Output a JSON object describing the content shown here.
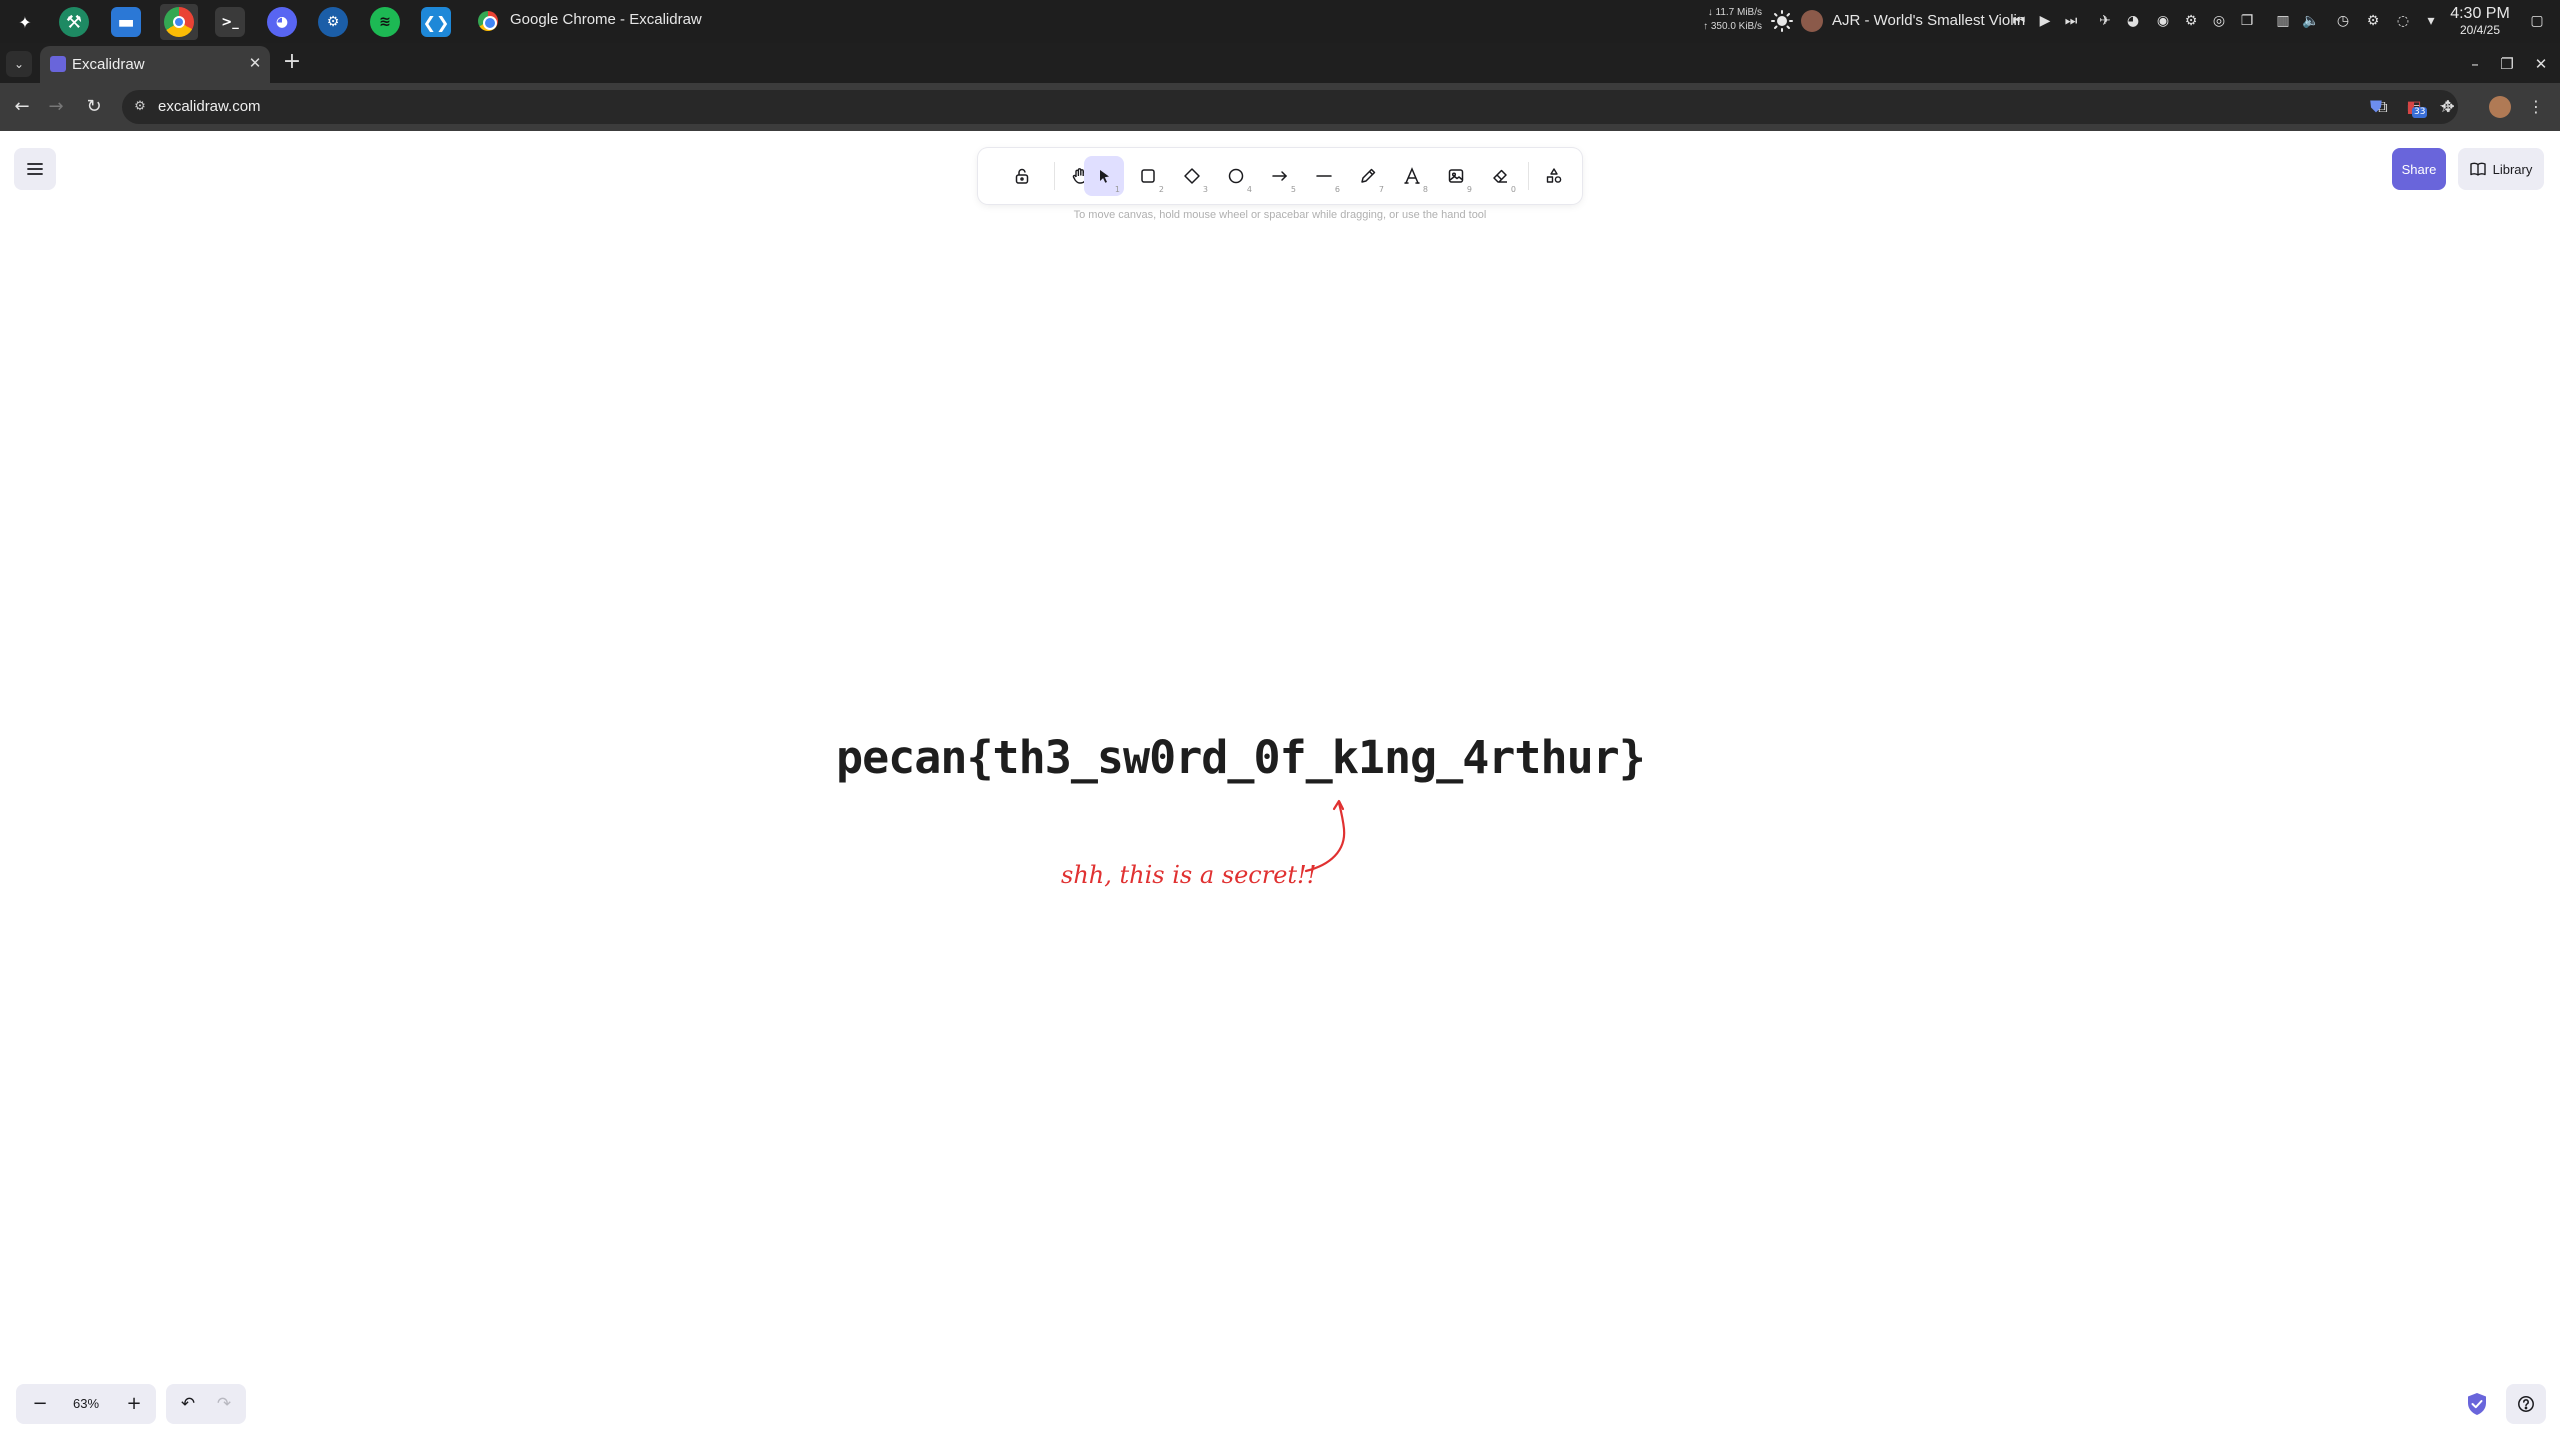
{
  "os": {
    "taskbar_apps": [
      {
        "name": "launcher",
        "icon": "sparkle-icon"
      },
      {
        "name": "klassy",
        "icon": "wrench-icon"
      },
      {
        "name": "files",
        "icon": "folder-icon"
      },
      {
        "name": "chrome",
        "icon": "chrome-icon"
      },
      {
        "name": "terminal",
        "icon": "terminal-icon"
      },
      {
        "name": "discord",
        "icon": "discord-icon"
      },
      {
        "name": "steam",
        "icon": "steam-icon"
      },
      {
        "name": "spotify",
        "icon": "spotify-icon"
      },
      {
        "name": "vscode",
        "icon": "vscode-icon"
      }
    ],
    "window_title": "Google Chrome - Excalidraw",
    "net_down": "↓ 11.7 MiB/s",
    "net_up": "↑ 350.0 KiB/s",
    "media_title": "AJR - World's Smallest Violin",
    "clock_time": "4:30 PM",
    "clock_date": "20/4/25"
  },
  "browser": {
    "tab_title": "Excalidraw",
    "url": "excalidraw.com",
    "extension_badge": "33"
  },
  "excalidraw": {
    "hint": "To move canvas, hold mouse wheel or spacebar while dragging, or use the hand tool",
    "share_label": "Share",
    "library_label": "Library",
    "tools": [
      {
        "name": "lock",
        "key": ""
      },
      {
        "name": "hand",
        "key": ""
      },
      {
        "name": "selection",
        "key": "1"
      },
      {
        "name": "rectangle",
        "key": "2"
      },
      {
        "name": "diamond",
        "key": "3"
      },
      {
        "name": "ellipse",
        "key": "4"
      },
      {
        "name": "arrow",
        "key": "5"
      },
      {
        "name": "line",
        "key": "6"
      },
      {
        "name": "draw",
        "key": "7"
      },
      {
        "name": "text",
        "key": "8"
      },
      {
        "name": "image",
        "key": "9"
      },
      {
        "name": "eraser",
        "key": "0"
      },
      {
        "name": "more-tools",
        "key": ""
      }
    ],
    "selected_tool": "selection",
    "canvas_text": "pecan{th3_sw0rd_0f_k1ng_4rthur}",
    "annotation_text": "shh, this is a secret!!",
    "annotation_color": "#e03131",
    "zoom_level": "63%",
    "accent_color": "#6965db"
  }
}
